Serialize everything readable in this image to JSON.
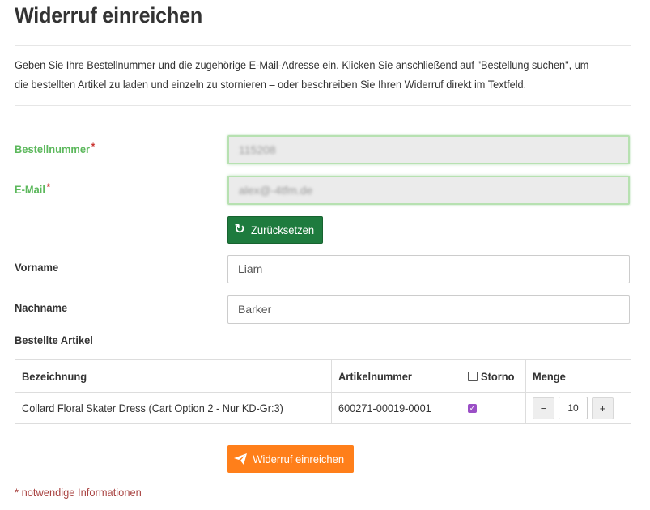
{
  "page": {
    "title": "Widerruf einreichen",
    "intro": "Geben Sie Ihre Bestellnummer und die zugehörige E-Mail-Adresse ein. Klicken Sie anschließend auf \"Bestellung suchen\", um die bestellten Artikel zu laden und einzeln zu stornieren – oder beschreiben Sie Ihren Widerruf direkt im Textfeld."
  },
  "form": {
    "order_number": {
      "label": "Bestellnummer",
      "required_mark": "*",
      "value": "115208"
    },
    "email": {
      "label": "E-Mail",
      "required_mark": "*",
      "value": "alex@-4tfm.de"
    },
    "reset_button": {
      "label": "Zurücksetzen",
      "icon": "refresh-icon"
    },
    "first_name": {
      "label": "Vorname",
      "value": "Liam"
    },
    "last_name": {
      "label": "Nachname",
      "value": "Barker"
    },
    "ordered_items_label": "Bestellte Artikel"
  },
  "table": {
    "headers": {
      "name": "Bezeichnung",
      "article_number": "Artikelnummer",
      "cancel": "Storno",
      "quantity": "Menge"
    },
    "rows": [
      {
        "name": "Collard Floral Skater Dress (Cart Option 2 - Nur KD-Gr:3)",
        "article_number": "600271-00019-0001",
        "cancel_checked": true,
        "quantity": "10",
        "minus": "−",
        "plus": "+"
      }
    ]
  },
  "submit_button": {
    "label": "Widerruf einreichen",
    "icon": "paper-plane-icon"
  },
  "footnote": "* notwendige Informationen",
  "colors": {
    "valid_label": "#5cb85c",
    "required": "#c9302c",
    "reset_button": "#1e7b3e",
    "submit_button": "#ff7f1a",
    "checkbox": "#9b4fc6",
    "footnote": "#a94442"
  }
}
